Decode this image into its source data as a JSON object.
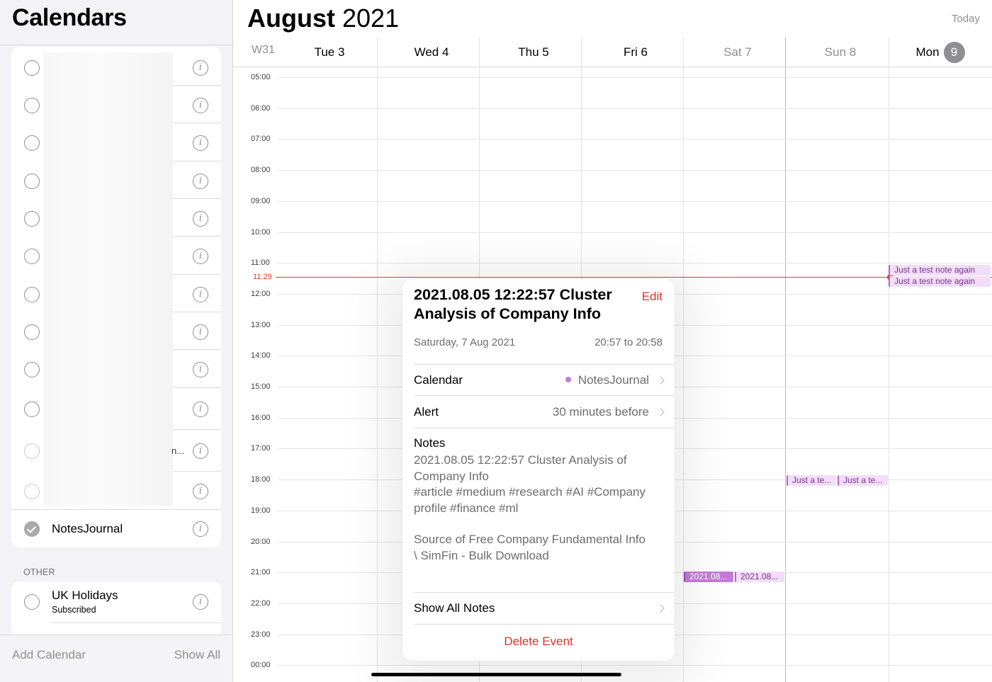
{
  "sidebar": {
    "title": "Calendars",
    "selected_calendar": "NotesJournal",
    "truncated_text": "n...",
    "other_label": "OTHER",
    "other": {
      "label": "UK Holidays",
      "sub": "Subscribed"
    },
    "footer": {
      "add": "Add Calendar",
      "show_all": "Show All"
    }
  },
  "header": {
    "month": "August",
    "year": "2021",
    "today": "Today",
    "week": "W31",
    "days": [
      "Tue 3",
      "Wed 4",
      "Thu 5",
      "Fri 6",
      "Sat 7",
      "Sun 8"
    ],
    "today_label": "Mon",
    "today_num": "9"
  },
  "grid": {
    "hours": [
      "05:00",
      "06:00",
      "07:00",
      "08:00",
      "09:00",
      "10:00",
      "11:00",
      "12:00",
      "13:00",
      "14:00",
      "15:00",
      "16:00",
      "17:00",
      "18:00",
      "19:00",
      "20:00",
      "21:00",
      "22:00",
      "23:00",
      "00:00"
    ],
    "now": "11:29"
  },
  "events": {
    "mon_1": "Just a test note again",
    "mon_2": "Just a test note again",
    "sun_1": "Just a te...",
    "sun_2": "Just a te...",
    "sat_1": "2021.08...",
    "sat_2": "2021.08..."
  },
  "popover": {
    "title": "2021.08.05 12:22:57 Cluster Analysis of Company Info",
    "edit": "Edit",
    "date": "Saturday, 7 Aug 2021",
    "time": "20:57 to 20:58",
    "calendar_label": "Calendar",
    "calendar_value": "NotesJournal",
    "alert_label": "Alert",
    "alert_value": "30 minutes before",
    "notes_label": "Notes",
    "notes_line1": "2021.08.05 12:22:57 Cluster Analysis of",
    "notes_line2": "Company Info",
    "notes_line3": "#article #medium #research #AI #Company",
    "notes_line4": "profile #finance #ml",
    "notes_line5": "Source of Free Company Fundamental Info",
    "notes_line6": "\\ SimFin - Bulk Download",
    "show_all": "Show All Notes",
    "delete": "Delete Event"
  },
  "colors": {
    "accent_red": "#e0312a",
    "event_purple": "#c57ad9",
    "now_line": "#e53935"
  }
}
